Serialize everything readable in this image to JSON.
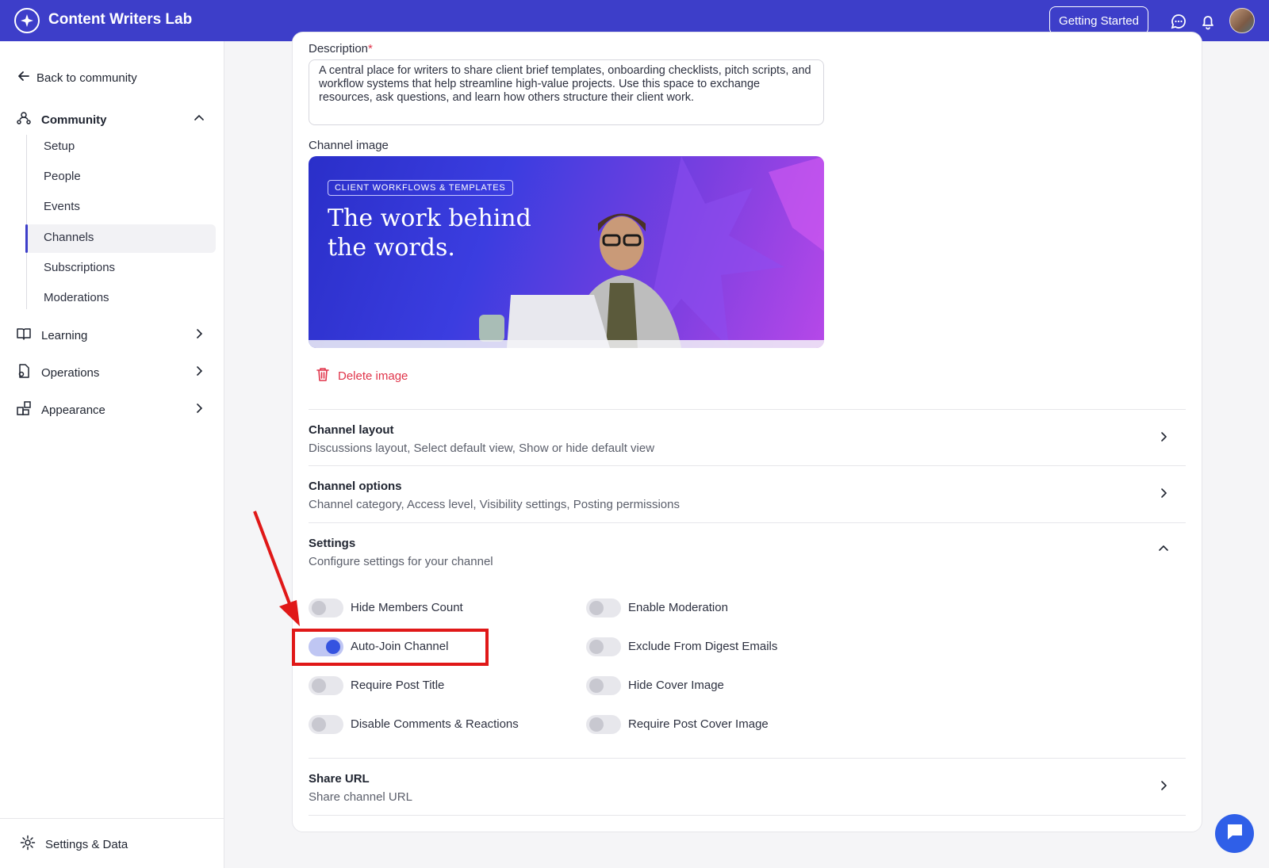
{
  "header": {
    "brand": "Content Writers Lab",
    "getting_started": "Getting Started"
  },
  "sidebar": {
    "back": "Back to community",
    "community": "Community",
    "sub_items": [
      "Setup",
      "People",
      "Events",
      "Channels",
      "Subscriptions",
      "Moderations"
    ],
    "active_item": "Channels",
    "learning": "Learning",
    "operations": "Operations",
    "appearance": "Appearance",
    "settings_data": "Settings & Data"
  },
  "form": {
    "description_label": "Description",
    "description_required": "*",
    "description_value": "A central place for writers to share client brief templates, onboarding checklists, pitch scripts, and workflow systems that help streamline high-value projects. Use this space to exchange resources, ask questions, and learn how others structure their client work.",
    "channel_image_label": "Channel image",
    "banner_tag": "CLIENT WORKFLOWS & TEMPLATES",
    "banner_title_line1": "The work behind",
    "banner_title_line2": "the words.",
    "delete_image": "Delete image"
  },
  "sections": {
    "layout_title": "Channel layout",
    "layout_sub": "Discussions layout, Select default view, Show or hide default view",
    "options_title": "Channel options",
    "options_sub": "Channel category, Access level, Visibility settings, Posting permissions",
    "settings_title": "Settings",
    "settings_sub": "Configure settings for your channel",
    "share_title": "Share URL",
    "share_sub": "Share channel URL"
  },
  "toggles": {
    "hide_members_count": {
      "label": "Hide Members Count",
      "on": false
    },
    "auto_join_channel": {
      "label": "Auto-Join Channel",
      "on": true
    },
    "require_post_title": {
      "label": "Require Post Title",
      "on": false
    },
    "disable_comments": {
      "label": "Disable Comments & Reactions",
      "on": false
    },
    "enable_moderation": {
      "label": "Enable Moderation",
      "on": false
    },
    "exclude_digest": {
      "label": "Exclude From Digest Emails",
      "on": false
    },
    "hide_cover_image": {
      "label": "Hide Cover Image",
      "on": false
    },
    "require_cover_image": {
      "label": "Require Post Cover Image",
      "on": false
    }
  },
  "colors": {
    "brand": "#3d3ec9",
    "accent": "#3553e0",
    "danger": "#e0344a",
    "annotation": "#e01818"
  }
}
